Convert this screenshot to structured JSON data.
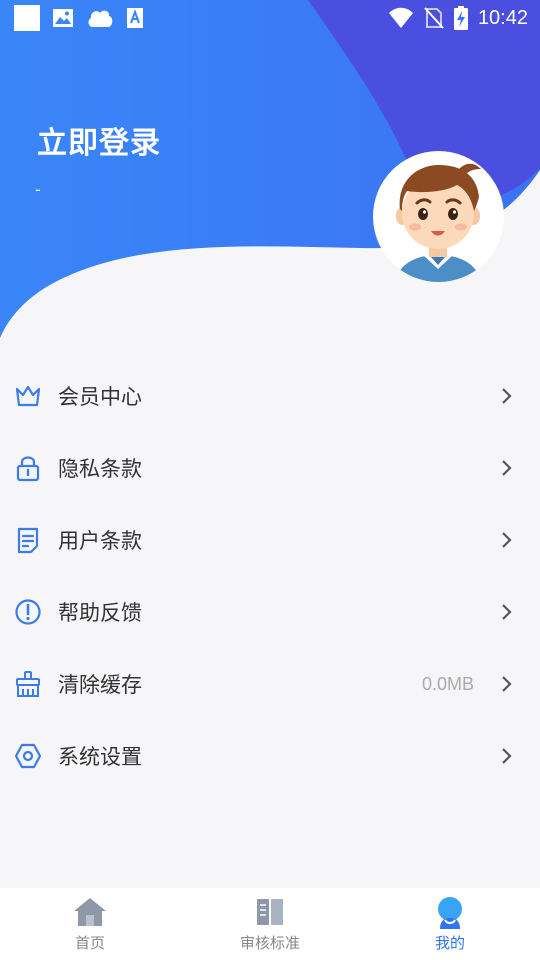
{
  "colors": {
    "header_blue": "#3a7df6",
    "header_indigo": "#4a4fe0",
    "accent": "#2f74f0",
    "icon_blue": "#3b7ce8"
  },
  "status_bar": {
    "time": "10:42",
    "left_icons": [
      "notification-square-icon",
      "image-icon",
      "cloud-icon",
      "font-a-icon"
    ],
    "right_icons": [
      "wifi-icon",
      "no-sim-icon",
      "battery-charging-icon"
    ]
  },
  "profile": {
    "title": "立即登录",
    "subtitle": "-",
    "avatar": "boy-avatar-icon"
  },
  "menu": {
    "items": [
      {
        "label": "会员中心",
        "icon": "crown-icon",
        "value": ""
      },
      {
        "label": "隐私条款",
        "icon": "lock-icon",
        "value": ""
      },
      {
        "label": "用户条款",
        "icon": "document-icon",
        "value": ""
      },
      {
        "label": "帮助反馈",
        "icon": "exclamation-circle-icon",
        "value": ""
      },
      {
        "label": "清除缓存",
        "icon": "broom-icon",
        "value": "0.0MB"
      },
      {
        "label": "系统设置",
        "icon": "hexagon-settings-icon",
        "value": ""
      }
    ]
  },
  "tabbar": {
    "tabs": [
      {
        "label": "首页",
        "icon": "home-icon",
        "active": false
      },
      {
        "label": "审核标准",
        "icon": "book-icon",
        "active": false
      },
      {
        "label": "我的",
        "icon": "user-icon",
        "active": true
      }
    ]
  }
}
